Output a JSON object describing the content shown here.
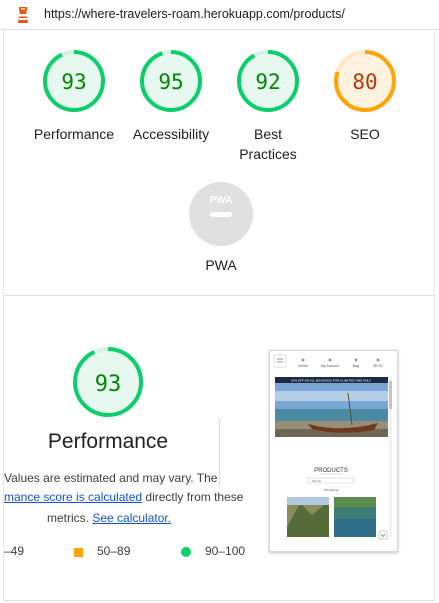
{
  "url": "https://where-travelers-roam.herokuapp.com/products/",
  "colors": {
    "pass": "#0cce6b",
    "average": "#ffa400",
    "pwa": "#e0e0e0"
  },
  "categories": [
    {
      "label": "Performance",
      "score": "93",
      "score_value": 93,
      "status": "pass"
    },
    {
      "label": "Accessibility",
      "score": "95",
      "score_value": 95,
      "status": "pass"
    },
    {
      "label_line1": "Best",
      "label_line2": "Practices",
      "score": "92",
      "score_value": 92,
      "status": "pass"
    },
    {
      "label": "SEO",
      "score": "80",
      "score_value": 80,
      "status": "average"
    }
  ],
  "pwa": {
    "label": "PWA",
    "badge": "PWA"
  },
  "performance": {
    "score": "93",
    "score_value": 93,
    "title": "Performance",
    "desc_line1": "Values are estimated and may vary. The",
    "desc_link1": "mance score is calculated",
    "desc_line2_rest": " directly from these",
    "desc_line3_prefix": "metrics. ",
    "desc_link2": "See calculator.",
    "legend": {
      "fail": "–49",
      "average": "50–89",
      "pass": "90–100"
    }
  },
  "thumbnail": {
    "nav": [
      "Home",
      "My Account",
      "Bag",
      "$0.00"
    ],
    "banner": "20% OFF ON ALL BOOKINGS FOR A LIMITED TIME ONLY",
    "heading": "PRODUCTS",
    "sort_label": "Sort by",
    "count": "6 Products"
  }
}
